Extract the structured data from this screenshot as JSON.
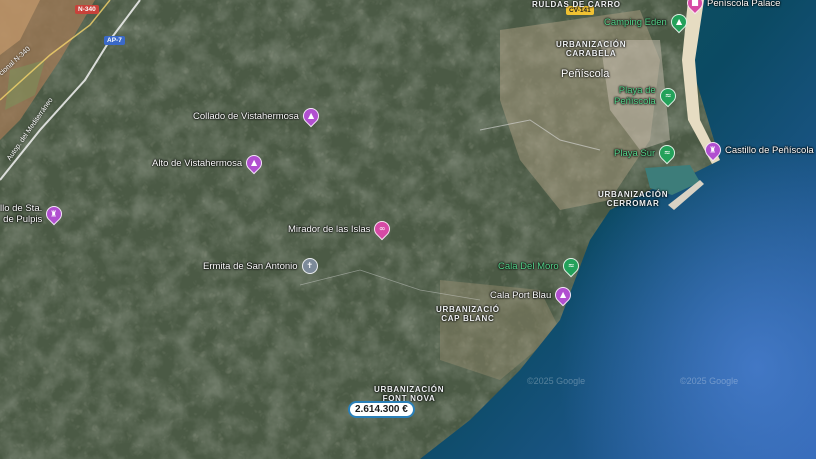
{
  "map": {
    "pois": [
      {
        "key": "collado",
        "name": "Collado de Vistahermosa",
        "icon": "viewpoint-icon",
        "color": "purple"
      },
      {
        "key": "alto",
        "name": "Alto de Vistahermosa",
        "icon": "viewpoint-icon",
        "color": "purple"
      },
      {
        "key": "pulpis",
        "name": "llo de Sta.\nde Pulpis",
        "icon": "castle-icon",
        "color": "purple"
      },
      {
        "key": "mirador",
        "name": "Mirador de las Islas",
        "icon": "binoculars-icon",
        "color": "pink"
      },
      {
        "key": "ermita",
        "name": "Ermita de San Antonio",
        "icon": "church-icon",
        "color": "gray"
      },
      {
        "key": "camping",
        "name": "Camping Eden",
        "icon": "tent-icon",
        "color": "green"
      },
      {
        "key": "playa_peniscola",
        "name": "Playa de\nPeñíscola",
        "icon": "beach-icon",
        "color": "green"
      },
      {
        "key": "playa_sur",
        "name": "Playa Sur",
        "icon": "beach-icon",
        "color": "green"
      },
      {
        "key": "castillo",
        "name": "Castillo de Peñíscola",
        "icon": "castle-icon",
        "color": "purple"
      },
      {
        "key": "cala_moro",
        "name": "Cala Del Moro",
        "icon": "beach-icon",
        "color": "green"
      },
      {
        "key": "cala_port_blau",
        "name": "Cala Port Blau",
        "icon": "viewpoint-icon",
        "color": "purple"
      },
      {
        "key": "peniscola_palace",
        "name": "Peníscola Palace",
        "icon": "hotel-icon",
        "color": "pink"
      }
    ],
    "areas": {
      "carabela": "URBANIZACIÓN\nCARABELA",
      "cerromar": "URBANIZACIÓN\nCERROMAR",
      "cap_blanc": "URBANIZACIÓ\nCAP BLANC",
      "font_nova": "URBANIZACIÓN\nFONT NOVA",
      "ruldas": "RULDAS DE CARRO"
    },
    "town": "Peñíscola",
    "roads": {
      "n340_shield": "N-340",
      "ap7_shield": "AP-7",
      "cv141_shield": "CV-141",
      "n340_label": "cional N-340",
      "autopista_label": "Autop. del Mediterráneo"
    },
    "price_tag": "2.614.300 €",
    "watermarks": [
      "©2025 Google",
      "©2025 Google"
    ]
  }
}
